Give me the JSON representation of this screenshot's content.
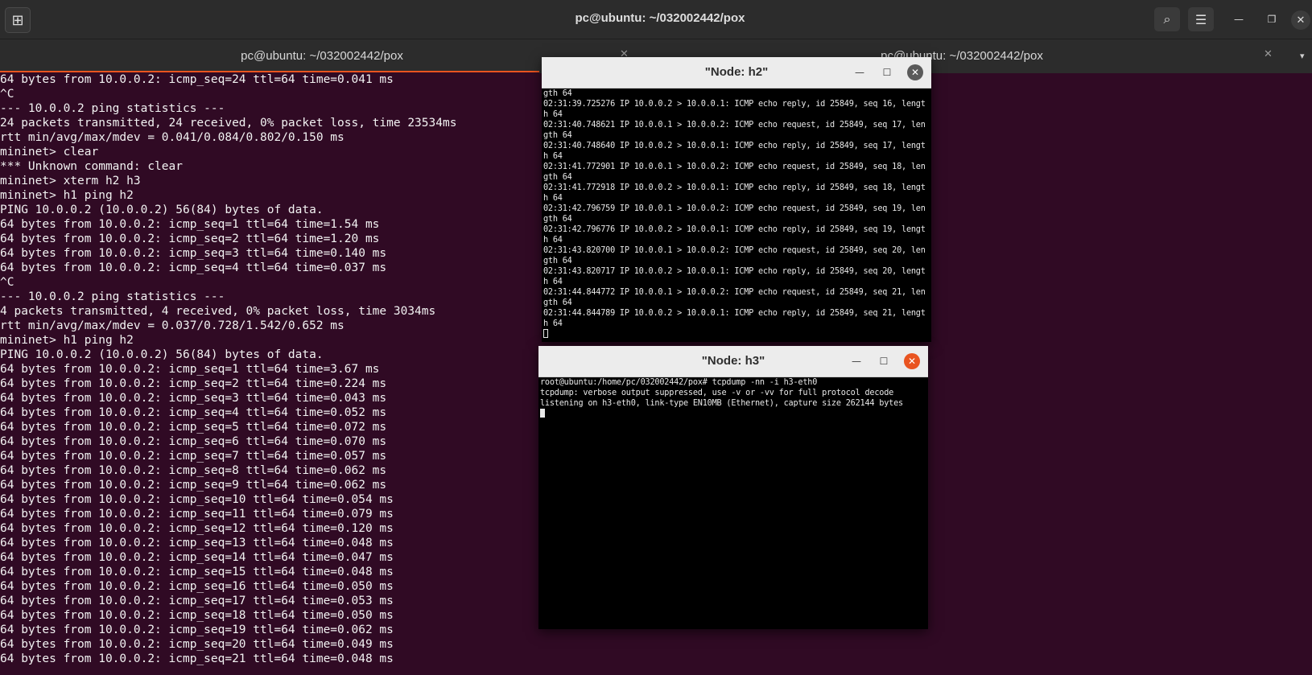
{
  "header": {
    "title": "pc@ubuntu: ~/032002442/pox",
    "new_tab_glyph": "⊞",
    "search_glyph": "⌕",
    "menu_glyph": "☰",
    "minimize_glyph": "—",
    "restore_glyph": "❐",
    "close_glyph": "✕"
  },
  "tabs": [
    {
      "label": "pc@ubuntu: ~/032002442/pox",
      "close": "✕"
    },
    {
      "label": "pc@ubuntu: ~/032002442/pox",
      "close": "✕"
    }
  ],
  "tab_menu_glyph": "▾",
  "terminal": {
    "lines": [
      "64 bytes from 10.0.0.2: icmp_seq=24 ttl=64 time=0.041 ms",
      "^C",
      "--- 10.0.0.2 ping statistics ---",
      "24 packets transmitted, 24 received, 0% packet loss, time 23534ms",
      "rtt min/avg/max/mdev = 0.041/0.084/0.802/0.150 ms",
      "mininet> clear",
      "*** Unknown command: clear",
      "mininet> xterm h2 h3",
      "mininet> h1 ping h2",
      "PING 10.0.0.2 (10.0.0.2) 56(84) bytes of data.",
      "64 bytes from 10.0.0.2: icmp_seq=1 ttl=64 time=1.54 ms",
      "64 bytes from 10.0.0.2: icmp_seq=2 ttl=64 time=1.20 ms",
      "64 bytes from 10.0.0.2: icmp_seq=3 ttl=64 time=0.140 ms",
      "64 bytes from 10.0.0.2: icmp_seq=4 ttl=64 time=0.037 ms",
      "^C",
      "--- 10.0.0.2 ping statistics ---",
      "4 packets transmitted, 4 received, 0% packet loss, time 3034ms",
      "rtt min/avg/max/mdev = 0.037/0.728/1.542/0.652 ms",
      "mininet> h1 ping h2",
      "PING 10.0.0.2 (10.0.0.2) 56(84) bytes of data.",
      "64 bytes from 10.0.0.2: icmp_seq=1 ttl=64 time=3.67 ms",
      "64 bytes from 10.0.0.2: icmp_seq=2 ttl=64 time=0.224 ms",
      "64 bytes from 10.0.0.2: icmp_seq=3 ttl=64 time=0.043 ms",
      "64 bytes from 10.0.0.2: icmp_seq=4 ttl=64 time=0.052 ms",
      "64 bytes from 10.0.0.2: icmp_seq=5 ttl=64 time=0.072 ms",
      "64 bytes from 10.0.0.2: icmp_seq=6 ttl=64 time=0.070 ms",
      "64 bytes from 10.0.0.2: icmp_seq=7 ttl=64 time=0.057 ms",
      "64 bytes from 10.0.0.2: icmp_seq=8 ttl=64 time=0.062 ms",
      "64 bytes from 10.0.0.2: icmp_seq=9 ttl=64 time=0.062 ms",
      "64 bytes from 10.0.0.2: icmp_seq=10 ttl=64 time=0.054 ms",
      "64 bytes from 10.0.0.2: icmp_seq=11 ttl=64 time=0.079 ms",
      "64 bytes from 10.0.0.2: icmp_seq=12 ttl=64 time=0.120 ms",
      "64 bytes from 10.0.0.2: icmp_seq=13 ttl=64 time=0.048 ms",
      "64 bytes from 10.0.0.2: icmp_seq=14 ttl=64 time=0.047 ms",
      "64 bytes from 10.0.0.2: icmp_seq=15 ttl=64 time=0.048 ms",
      "64 bytes from 10.0.0.2: icmp_seq=16 ttl=64 time=0.050 ms",
      "64 bytes from 10.0.0.2: icmp_seq=17 ttl=64 time=0.053 ms",
      "64 bytes from 10.0.0.2: icmp_seq=18 ttl=64 time=0.050 ms",
      "64 bytes from 10.0.0.2: icmp_seq=19 ttl=64 time=0.062 ms",
      "64 bytes from 10.0.0.2: icmp_seq=20 ttl=64 time=0.049 ms",
      "64 bytes from 10.0.0.2: icmp_seq=21 ttl=64 time=0.048 ms"
    ]
  },
  "node_h2": {
    "title": "\"Node: h2\"",
    "lines": [
      "gth 64",
      "02:31:39.725276 IP 10.0.0.2 > 10.0.0.1: ICMP echo reply, id 25849, seq 16, lengt",
      "h 64",
      "02:31:40.748621 IP 10.0.0.1 > 10.0.0.2: ICMP echo request, id 25849, seq 17, len",
      "gth 64",
      "02:31:40.748640 IP 10.0.0.2 > 10.0.0.1: ICMP echo reply, id 25849, seq 17, lengt",
      "h 64",
      "02:31:41.772901 IP 10.0.0.1 > 10.0.0.2: ICMP echo request, id 25849, seq 18, len",
      "gth 64",
      "02:31:41.772918 IP 10.0.0.2 > 10.0.0.1: ICMP echo reply, id 25849, seq 18, lengt",
      "h 64",
      "02:31:42.796759 IP 10.0.0.1 > 10.0.0.2: ICMP echo request, id 25849, seq 19, len",
      "gth 64",
      "02:31:42.796776 IP 10.0.0.2 > 10.0.0.1: ICMP echo reply, id 25849, seq 19, lengt",
      "h 64",
      "02:31:43.820700 IP 10.0.0.1 > 10.0.0.2: ICMP echo request, id 25849, seq 20, len",
      "gth 64",
      "02:31:43.820717 IP 10.0.0.2 > 10.0.0.1: ICMP echo reply, id 25849, seq 20, lengt",
      "h 64",
      "02:31:44.844772 IP 10.0.0.1 > 10.0.0.2: ICMP echo request, id 25849, seq 21, len",
      "gth 64",
      "02:31:44.844789 IP 10.0.0.2 > 10.0.0.1: ICMP echo reply, id 25849, seq 21, lengt",
      "h 64"
    ]
  },
  "node_h3": {
    "title": "\"Node: h3\"",
    "lines": [
      "root@ubuntu:/home/pc/032002442/pox# tcpdump -nn -i h3-eth0",
      "tcpdump: verbose output suppressed, use -v or -vv for full protocol decode",
      "listening on h3-eth0, link-type EN10MB (Ethernet), capture size 262144 bytes"
    ]
  },
  "colors": {
    "terminal_bg": "#300a24",
    "accent": "#e95420",
    "close_active": "#e95420",
    "close_inactive": "#5a5a5a"
  }
}
